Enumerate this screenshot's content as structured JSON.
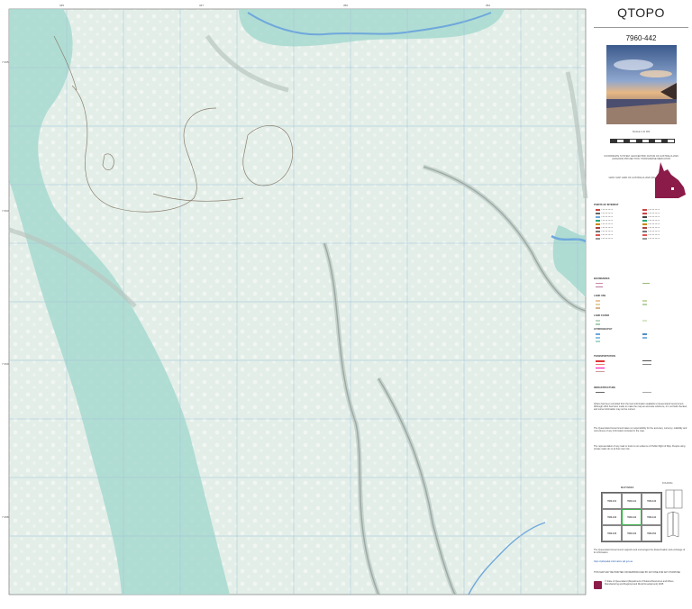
{
  "header": {
    "brand": "QTOPO",
    "map_number": "7960-442",
    "scale_label": "SCALE 1:10 000",
    "projection_note": "COORDINATE SYSTEM: GEOCENTRIC DATUM OF AUSTRALIA 2020 (GDA2020) PROJECTION: TRANSVERSE MERCATOR",
    "grid_note": "GRID: MAP GRID OF AUSTRALIA 2020 (MGA2020) ZONE 56"
  },
  "legend": {
    "title": "POINTS OF INTEREST",
    "sections": {
      "boundaries": "BOUNDARIES",
      "land_use": "LAND USE",
      "land_cover": "LAND COVER",
      "hydrography": "HYDROGRAPHY",
      "transportation": "TRANSPORTATION",
      "infrastructure": "INFRASTRUCTURE"
    }
  },
  "disclaimer": {
    "p1": "QTopo has been compiled from the best information available to Queensland Government. Although effort has been made to make the map as accurate reference, it is not field checked, and some information may not be current.",
    "p2": "The Queensland Government takes no responsibility for the accuracy, currency, reliability and correctness of any information included in the map.",
    "p3": "The representation of any road or track is not evidence of Public Right of Way. People using private roads do so at their own risk."
  },
  "index": {
    "title": "MAP INDEX",
    "sheets": [
      "7960-431",
      "7960-441",
      "7960-443",
      "7960-432",
      "7960-442",
      "7960-444",
      "7960-433",
      "7960-434",
      "7960-454"
    ]
  },
  "fold_label": "FOLDING",
  "footer": {
    "support": "The Queensland Government supports and encourages the dissemination and exchange of its information.",
    "url": "https://qldspatial.information.qld.gov.au",
    "not_for_resale": "THIS MAP MAY BE PRINTED OR REPRODUCED BY ANYONE FOR ANY PURPOSE",
    "copyright": "© State of Queensland (Department of Natural Resources and Mines, Manufacturing and Regional and Rural Development) 2025"
  },
  "colors": {
    "land": "#e4efe9",
    "water_band": "#a7d9cf",
    "river": "#6fa8dc",
    "contour": "#8a7f6e",
    "grid": "#9fc2d8",
    "relief_shadow": "#b9c6c1",
    "state_fill": "#8b1c4a"
  },
  "grid_labels": {
    "top": [
      "345",
      "346",
      "347",
      "348",
      "349",
      "350",
      "351",
      "352",
      "353",
      "354"
    ],
    "left": [
      "7 095",
      "7 094",
      "7 093",
      "7 092",
      "7 091",
      "7 090",
      "7 089",
      "7 088",
      "7 087",
      "7 086"
    ]
  }
}
